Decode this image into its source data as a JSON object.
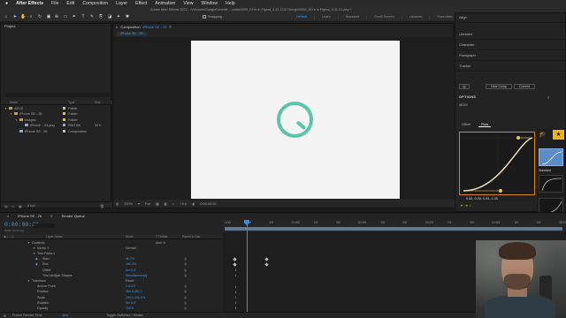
{
  "menubar": {
    "apple": "",
    "app": "After Effects",
    "items": [
      "File",
      "Edit",
      "Composition",
      "Layer",
      "Effect",
      "Animation",
      "View",
      "Window",
      "Help"
    ]
  },
  "window_title": "Adobe After Effects 2022 - /Volumes/GoogleDrive/M... orials/0009_DIYs in Figma_4-11-21/2 Design/0009_DIYs in Figma_4-11-21.aep *",
  "toolbar": {
    "snapping_label": "Snapping",
    "workspaces": [
      "Default",
      "Learn",
      "Standard",
      "Small Screen",
      "Libraries",
      "Essentials"
    ],
    "active_workspace": "Default",
    "search_help": "Search Help"
  },
  "project": {
    "tab": "Project",
    "columns": {
      "name": "Name",
      "type": "Type",
      "size": "Size"
    },
    "rows": [
      {
        "name": "AEUX",
        "type": "Folder",
        "size": "",
        "kind": "folder",
        "indent": 0,
        "expanded": true,
        "label_color": "#e2c04a"
      },
      {
        "name": "iPhone SE - 26",
        "type": "Folder",
        "size": "",
        "kind": "folder",
        "indent": 1,
        "expanded": true,
        "label_color": "#e2c04a"
      },
      {
        "name": "Images",
        "type": "Folder",
        "size": "",
        "kind": "folder",
        "indent": 2,
        "expanded": true,
        "label_color": "#e2c04a"
      },
      {
        "name": "iPhone ...24.png",
        "type": "PNG file",
        "size": "39 K",
        "kind": "file",
        "indent": 3,
        "expanded": false,
        "label_color": "#9aa3c9"
      },
      {
        "name": "iPhone SE - 26",
        "type": "Composition",
        "size": "",
        "kind": "comp",
        "indent": 2,
        "expanded": false,
        "label_color": "#a9c3d6"
      }
    ],
    "footer_bpc": "8 bpc"
  },
  "composition": {
    "panel_tab": "Composition",
    "comp_name": "iPhone SE - 26",
    "subtab": "iPhone SE - 26",
    "zoom": "200%",
    "resolution": "Full",
    "plus_value": "+0.0",
    "timecode": "0:00:00:20",
    "accent": "#5cc4a8"
  },
  "right_panel": {
    "items": [
      "Align",
      "Libraries",
      "Character",
      "Paragraph",
      "Tracker"
    ],
    "options_label": "OPTIONS",
    "new_comp": "New Comp",
    "current": "Current",
    "aeux_label": "AEUX",
    "tabs": [
      "Offset",
      "Flow"
    ],
    "active_tab": "Flow",
    "bezier_values": "0.52, 0.00, 0.94, 1.00",
    "apply": "APPLY",
    "preset_label": "Standard"
  },
  "timeline": {
    "comp_tab": "iPhone SE - 26",
    "render_queue": "Render Queue",
    "time": "0:00:00:20",
    "fps": "00020 (30.00 fps)",
    "columns": {
      "layer_name": "Layer Name",
      "mode": "Mode",
      "trkmat": "T TrkMat",
      "parent": "Parent & Link"
    },
    "rows": [
      {
        "label": "Contents",
        "value": "",
        "extra": "Add: ⊙",
        "indent": 1,
        "kind": "group"
      },
      {
        "label": "Vector 1",
        "value": "",
        "extra": "Normal",
        "indent": 2,
        "kind": "group"
      },
      {
        "label": "Trim Paths 1",
        "value": "",
        "extra": "",
        "indent": 2,
        "kind": "group"
      },
      {
        "label": "Start",
        "value": "46.7%",
        "extra": "",
        "indent": 3,
        "kind": "prop",
        "keyframes": [
          12,
          48
        ]
      },
      {
        "label": "End",
        "value": "100.0%",
        "extra": "",
        "indent": 3,
        "kind": "prop",
        "keyframes": [
          12,
          48
        ]
      },
      {
        "label": "Offset",
        "value": "0x+0.0°",
        "extra": "",
        "indent": 3,
        "kind": "prop",
        "keyframes": []
      },
      {
        "label": "Trim Multiple Shapes",
        "value": "Simultaneously",
        "extra": "",
        "indent": 3,
        "kind": "prop",
        "keyframes": []
      },
      {
        "label": "Transform",
        "value": "Reset",
        "extra": "",
        "indent": 1,
        "kind": "group"
      },
      {
        "label": "Anchor Point",
        "value": "0.0,0.0",
        "extra": "",
        "indent": 2,
        "kind": "prop",
        "keyframes": []
      },
      {
        "label": "Position",
        "value": "160.0,452.1",
        "extra": "",
        "indent": 2,
        "kind": "prop",
        "keyframes": []
      },
      {
        "label": "Scale",
        "value": "100.0,100.0%",
        "extra": "",
        "indent": 2,
        "kind": "prop",
        "keyframes": []
      },
      {
        "label": "Rotation",
        "value": "0x+0.0°",
        "extra": "",
        "indent": 2,
        "kind": "prop",
        "keyframes": []
      },
      {
        "label": "Opacity",
        "value": "100%",
        "extra": "",
        "indent": 2,
        "kind": "prop",
        "keyframes": []
      }
    ],
    "ruler_ticks": [
      "0:00f",
      "10f",
      "20f",
      "01:00f",
      "10f",
      "20f",
      "02:00f",
      "10f",
      "20f",
      "03:00f",
      "10f",
      "20f",
      "04:00f",
      "10f",
      "20f",
      "05:00f"
    ],
    "frame_render": "Frame Render Time",
    "frame_render_value": "1ms",
    "toggle_switches": "Toggle Switches / Modes"
  }
}
